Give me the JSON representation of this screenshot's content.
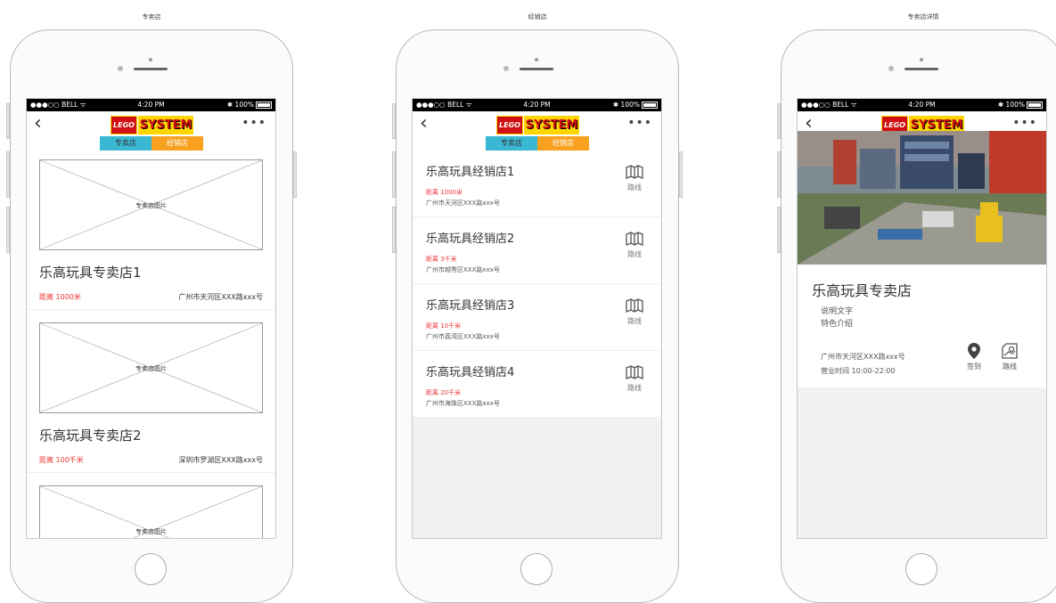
{
  "captions": [
    "专卖店",
    "经销店",
    "专卖店详情"
  ],
  "status": {
    "carrier": "●●●○○ BELL ᯤ",
    "time": "4:20 PM",
    "battery": "✱ 100%"
  },
  "nav": {
    "back": "‹",
    "more": "•••",
    "logo_left": "LEGO",
    "logo_right": "SYSTEM"
  },
  "tabs": {
    "exclusive": "专卖店",
    "dealer": "经销店"
  },
  "exclusive_stores": [
    {
      "image_label": "专卖店图片",
      "name": "乐高玩具专卖店1",
      "distance": "距离 1000米",
      "address": "广州市天河区XXX路xxx号"
    },
    {
      "image_label": "专卖店图片",
      "name": "乐高玩具专卖店2",
      "distance": "距离 100千米",
      "address": "深圳市罗湖区XXX路xxx号"
    },
    {
      "image_label": "专卖店图片"
    }
  ],
  "dealers": [
    {
      "name": "乐高玩具经销店1",
      "distance": "距离 1000米",
      "address": "广州市天河区XXX路xxx号",
      "route": "路线"
    },
    {
      "name": "乐高玩具经销店2",
      "distance": "距离 3千米",
      "address": "广州市越秀区XXX路xxx号",
      "route": "路线"
    },
    {
      "name": "乐高玩具经销店3",
      "distance": "距离 10千米",
      "address": "广州市荔湾区XXX路xxx号",
      "route": "路线"
    },
    {
      "name": "乐高玩具经销店4",
      "distance": "距离 20千米",
      "address": "广州市海珠区XXX路xxx号",
      "route": "路线"
    }
  ],
  "detail": {
    "name": "乐高玩具专卖店",
    "desc1": "说明文字",
    "desc2": "特色介绍",
    "address": "广州市天河区XXX路xxx号",
    "hours": "营业时间 10:00-22:00",
    "checkin": "签到",
    "route": "路线"
  },
  "colors": {
    "tab_exclusive": "#3ab7d3",
    "tab_dealer": "#f7a11f",
    "distance": "#e33333"
  }
}
